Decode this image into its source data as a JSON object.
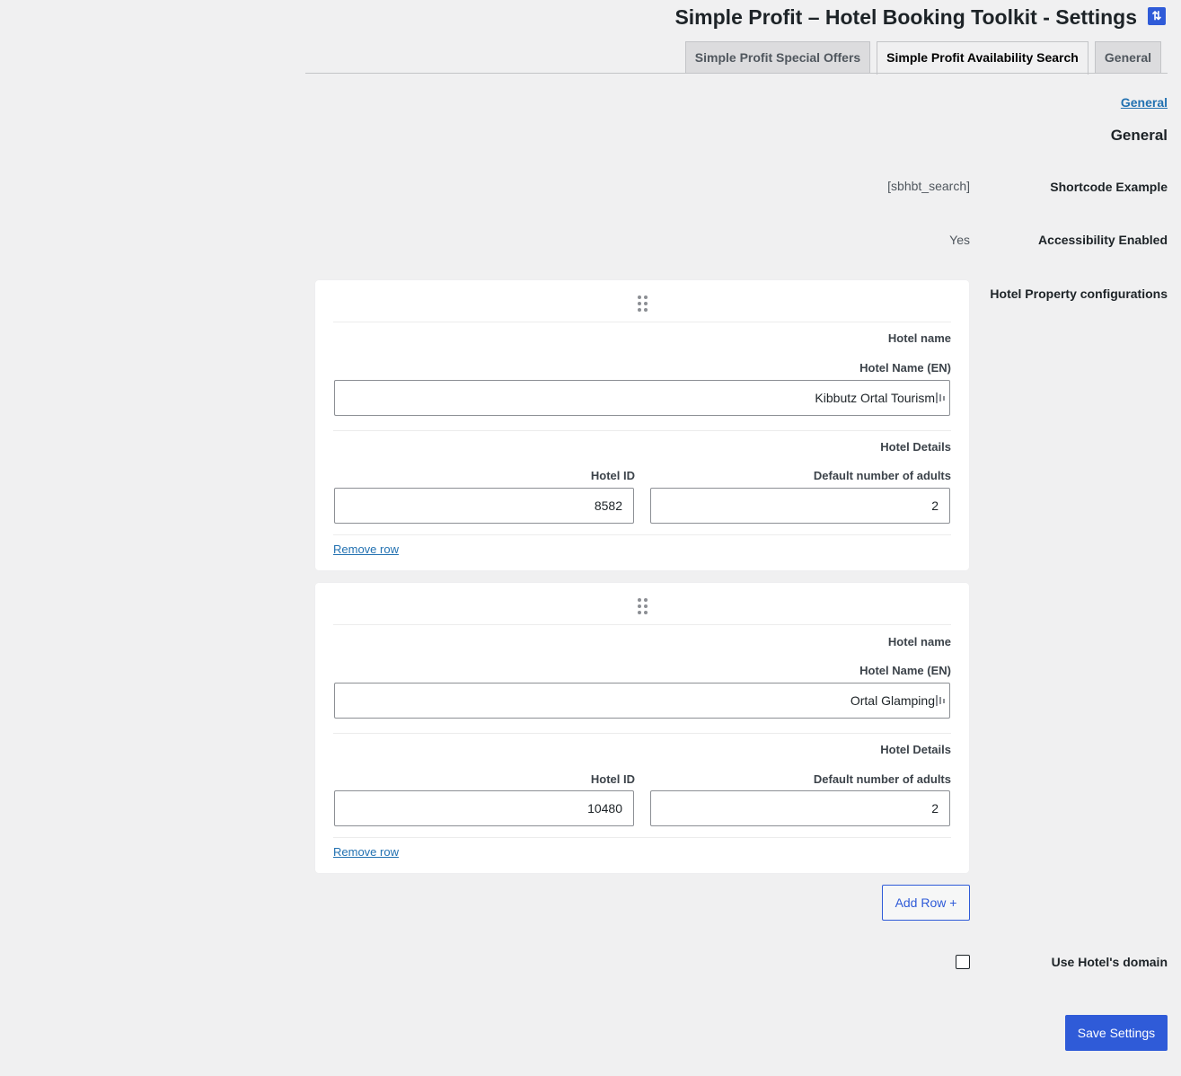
{
  "header": {
    "title": "Simple Profit – Hotel Booking Toolkit - Settings",
    "icon": "sort-arrows-icon"
  },
  "tabs": [
    {
      "label": "Simple Profit Special Offers",
      "active": false
    },
    {
      "label": "Simple Profit Availability Search",
      "active": true
    },
    {
      "label": "General",
      "active": false
    }
  ],
  "section": {
    "link": "General",
    "heading": "General"
  },
  "settings": {
    "shortcode_label": "Shortcode Example",
    "shortcode_value": "[sbhbt_search]",
    "accessibility_label": "Accessibility Enabled",
    "accessibility_value": "Yes",
    "hotels_label": "Hotel Property configurations",
    "hotel_domain_label": "Use Hotel's domain",
    "hotel_domain_checked": false
  },
  "hotels": [
    {
      "group_name_label": "Hotel name",
      "name_field_label": "Hotel Name (EN)",
      "name": "Kibbutz Ortal Tourism",
      "details_label": "Hotel Details",
      "id_label": "Hotel ID",
      "id": "8582",
      "adults_label": "Default number of adults",
      "adults": "2",
      "remove_label": "Remove row"
    },
    {
      "group_name_label": "Hotel name",
      "name_field_label": "Hotel Name (EN)",
      "name": "Ortal Glamping",
      "details_label": "Hotel Details",
      "id_label": "Hotel ID",
      "id": "10480",
      "adults_label": "Default number of adults",
      "adults": "2",
      "remove_label": "Remove row"
    }
  ],
  "actions": {
    "add_row": "Add Row +",
    "save": "Save Settings"
  },
  "colors": {
    "accent": "#2f5bd8",
    "link": "#2271b1",
    "background": "#f0f0f1"
  }
}
